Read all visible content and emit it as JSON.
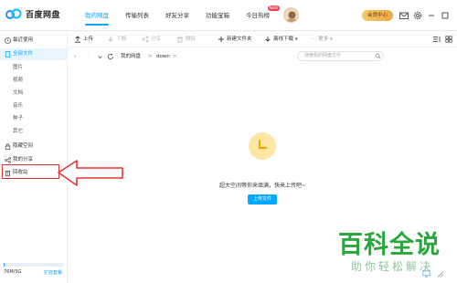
{
  "app": {
    "title": "百度网盘"
  },
  "nav": {
    "tabs": [
      {
        "label": "我的网盘",
        "active": true
      },
      {
        "label": "传输列表"
      },
      {
        "label": "好友分享"
      },
      {
        "label": "功能宝箱"
      },
      {
        "label": "今日热榜",
        "badge": "NEW"
      }
    ]
  },
  "header": {
    "vip_label": "会员中心"
  },
  "sidebar": {
    "items": [
      {
        "label": "最近使用"
      },
      {
        "label": "全部文件"
      }
    ],
    "subitems": [
      "图片",
      "视频",
      "文档",
      "音乐",
      "种子",
      "其它"
    ],
    "bottom_items": [
      {
        "label": "隐藏空间"
      },
      {
        "label": "我的分享"
      },
      {
        "label": "回收站"
      }
    ],
    "quota": {
      "text": "76M/5G",
      "used_fraction": 0.02,
      "expand_label": "扩容套餐"
    }
  },
  "toolbar": {
    "upload": "上传",
    "download": "下载",
    "share": "分享",
    "delete": "删除",
    "new_folder": "新建文件夹",
    "offline_download": "离线下载",
    "more": "更多"
  },
  "path": {
    "root": "我的网盘",
    "sep1": ">",
    "current": "down",
    "sep2": ">",
    "search_placeholder": "搜索我的网盘文件"
  },
  "empty_state": {
    "message": "超大空间等你来填满，快来上传吧~",
    "upload_button": "上传文件"
  },
  "watermark": {
    "title": "百科全说",
    "subtitle": "助你轻松解决"
  },
  "colors": {
    "accent": "#06a7ff",
    "highlight": "#e53333",
    "watermark": "#2aa73c"
  }
}
